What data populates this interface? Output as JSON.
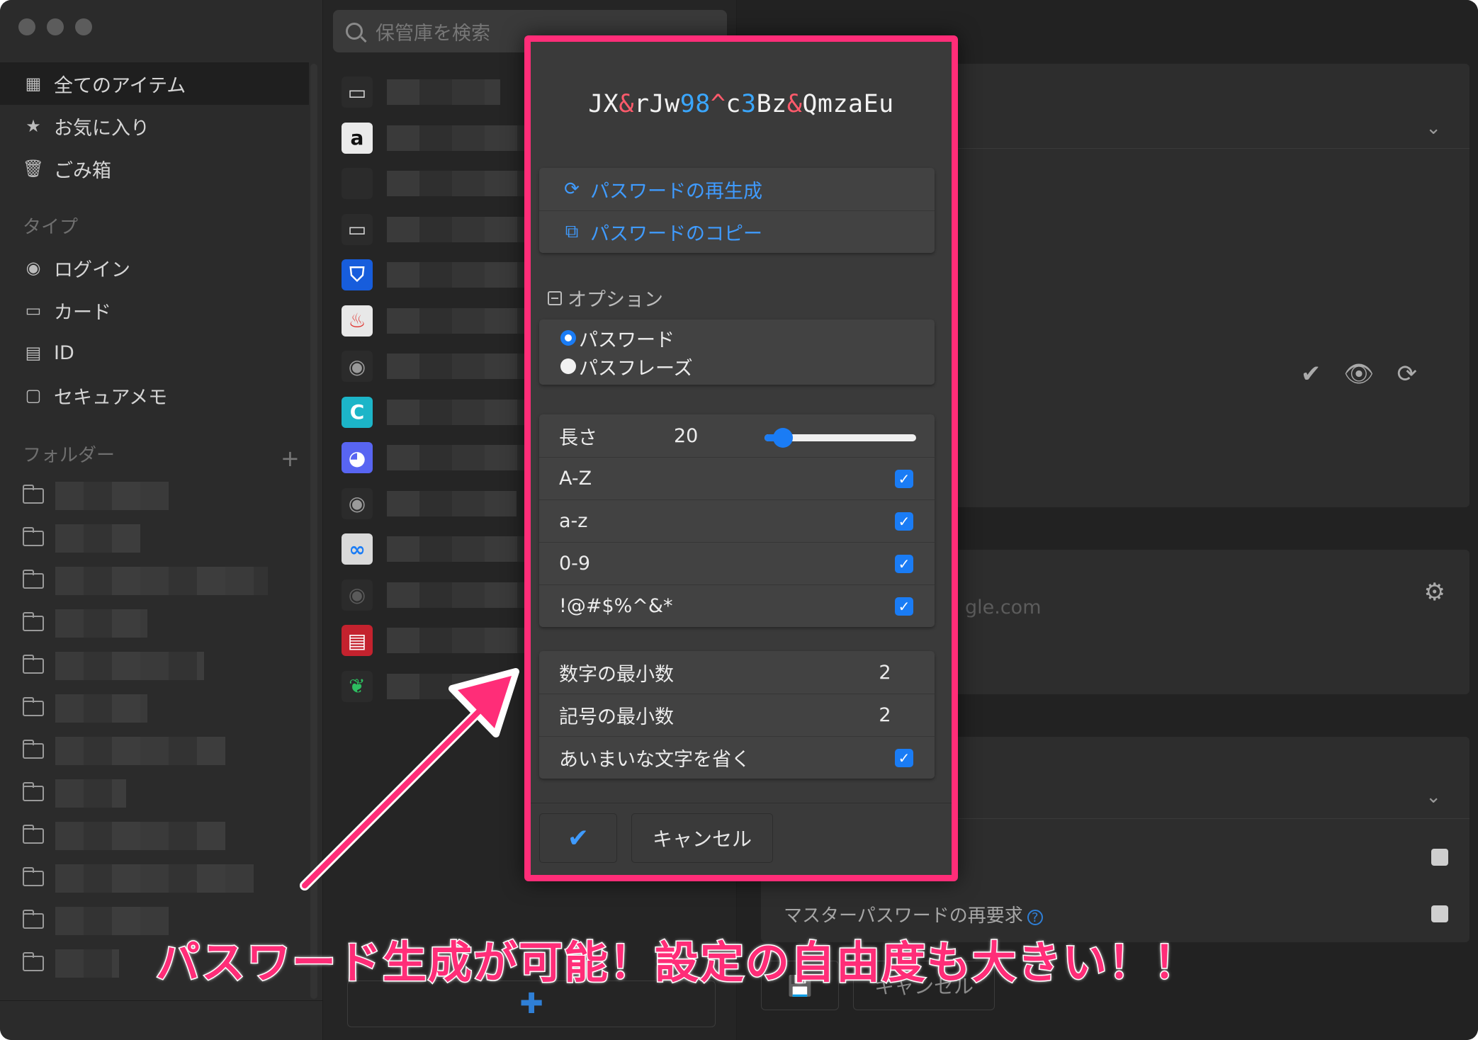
{
  "sidebar": {
    "items": [
      {
        "label": "全てのアイテム",
        "icon": "grid-icon"
      },
      {
        "label": "お気に入り",
        "icon": "star-icon"
      },
      {
        "label": "ごみ箱",
        "icon": "trash-icon"
      }
    ],
    "type_heading": "タイプ",
    "types": [
      {
        "label": "ログイン",
        "icon": "globe-icon"
      },
      {
        "label": "カード",
        "icon": "card-icon"
      },
      {
        "label": "ID",
        "icon": "id-card-icon"
      },
      {
        "label": "セキュアメモ",
        "icon": "note-icon"
      }
    ],
    "folder_heading": "フォルダー",
    "add_folder": "+"
  },
  "search": {
    "placeholder": "保管庫を検索"
  },
  "list_icons": [
    {
      "name": "card-icon",
      "glyph": "▭",
      "bg": "#2b2b2b",
      "color": "#cfcfcf"
    },
    {
      "name": "amazon-icon",
      "glyph": "a",
      "bg": "#eaeaea",
      "color": "#111"
    },
    {
      "name": "apple-icon",
      "glyph": "",
      "bg": "#2b2b2b",
      "color": "#cfcfcf"
    },
    {
      "name": "card-icon",
      "glyph": "▭",
      "bg": "#2b2b2b",
      "color": "#cfcfcf"
    },
    {
      "name": "bitwarden-icon",
      "glyph": "⛉",
      "bg": "#175ddc",
      "color": "#fff"
    },
    {
      "name": "fire-icon",
      "glyph": "♨",
      "bg": "#e8e8e8",
      "color": "#e0322d"
    },
    {
      "name": "globe-icon",
      "glyph": "◉",
      "bg": "#2b2b2b",
      "color": "#9a9a9a"
    },
    {
      "name": "c-app-icon",
      "glyph": "C",
      "bg": "#1cb5c8",
      "color": "#fff"
    },
    {
      "name": "discord-icon",
      "glyph": "◕",
      "bg": "#5865f2",
      "color": "#fff"
    },
    {
      "name": "globe-icon",
      "glyph": "◉",
      "bg": "#2b2b2b",
      "color": "#9a9a9a"
    },
    {
      "name": "infinity-icon",
      "glyph": "∞",
      "bg": "#dadada",
      "color": "#1a7cf5"
    },
    {
      "name": "globe-icon",
      "glyph": "◉",
      "bg": "#2b2b2b",
      "color": "#5a5a5a"
    },
    {
      "name": "red-app-icon",
      "glyph": "▤",
      "bg": "#c4222e",
      "color": "#fff"
    },
    {
      "name": "evernote-icon",
      "glyph": "❦",
      "bg": "#2b2b2b",
      "color": "#2dbe60"
    }
  ],
  "generator": {
    "password_parts": [
      {
        "t": "JX",
        "k": "char"
      },
      {
        "t": "&",
        "k": "sym"
      },
      {
        "t": "rJw",
        "k": "char"
      },
      {
        "t": "98",
        "k": "num"
      },
      {
        "t": "^",
        "k": "sym"
      },
      {
        "t": "c",
        "k": "char"
      },
      {
        "t": "3",
        "k": "num"
      },
      {
        "t": "Bz",
        "k": "char"
      },
      {
        "t": "&",
        "k": "sym"
      },
      {
        "t": "QmzaEu",
        "k": "char"
      }
    ],
    "regenerate_label": "パスワードの再生成",
    "copy_label": "パスワードのコピー",
    "options_heading": "オプション",
    "type_password": "パスワード",
    "type_passphrase": "パスフレーズ",
    "selected_type": "password",
    "length_label": "長さ",
    "length_value": "20",
    "length_min": 5,
    "length_max": 128,
    "upper_label": "A-Z",
    "lower_label": "a-z",
    "number_label": "0-9",
    "special_label": "!@#$%^&*",
    "min_numbers_label": "数字の最小数",
    "min_numbers_value": "2",
    "min_special_label": "記号の最小数",
    "min_special_value": "2",
    "avoid_ambiguous_label": "あいまいな文字を省く",
    "ok_label": "✔",
    "cancel_label": "キャンセル"
  },
  "right": {
    "partial_url": "gle.com",
    "master_reprompt_label": "マスターパスワードの再要求",
    "help_icon": "?",
    "cancel_label": "キャンセル"
  },
  "annotation": {
    "caption": "パスワード生成が可能！設定の自由度も大きい！！",
    "accent": "#ff2d78"
  }
}
